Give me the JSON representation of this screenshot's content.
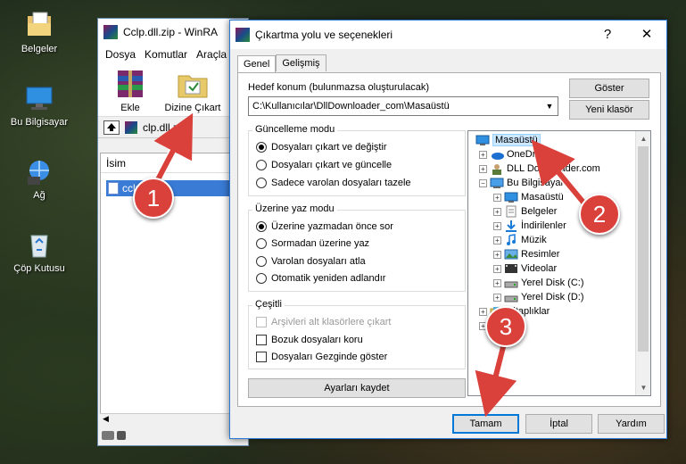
{
  "desktop": {
    "icons": [
      {
        "label": "Belgeler",
        "icon": "documents-folder-icon"
      },
      {
        "label": "Bu Bilgisayar",
        "icon": "computer-icon"
      },
      {
        "label": "Ağ",
        "icon": "network-icon"
      },
      {
        "label": "Çöp Kutusu",
        "icon": "recycle-bin-icon"
      }
    ]
  },
  "winrar": {
    "title": "Cclp.dll.zip - WinRA",
    "menu": [
      "Dosya",
      "Komutlar",
      "Araçla"
    ],
    "toolbar": {
      "add": "Ekle",
      "extract_to": "Dizine Çıkart"
    },
    "path": "clp.dll.zip",
    "column_name": "İsim",
    "file": "cclp"
  },
  "dialog": {
    "title": "Çıkartma yolu ve seçenekleri",
    "help": "?",
    "close": "✕",
    "tabs": [
      "Genel",
      "Gelişmiş"
    ],
    "dest_label": "Hedef konum (bulunmazsa oluşturulacak)",
    "dest_value": "C:\\Kullanıcılar\\DllDownloader_com\\Masaüstü",
    "show_button": "Göster",
    "new_folder_button": "Yeni klasör",
    "update_mode": {
      "title": "Güncelleme modu",
      "options": [
        "Dosyaları çıkart ve değiştir",
        "Dosyaları çıkart ve güncelle",
        "Sadece varolan dosyaları tazele"
      ],
      "selected": 0
    },
    "overwrite_mode": {
      "title": "Üzerine yaz modu",
      "options": [
        "Üzerine yazmadan önce sor",
        "Sormadan üzerine yaz",
        "Varolan dosyaları atla",
        "Otomatik yeniden adlandır"
      ],
      "selected": 0
    },
    "misc": {
      "title": "Çeşitli",
      "options": [
        {
          "label": "Arşivleri alt klasörlere çıkart",
          "checked": false,
          "disabled": true
        },
        {
          "label": "Bozuk dosyaları koru",
          "checked": false,
          "disabled": false
        },
        {
          "label": "Dosyaları Gezginde göster",
          "checked": false,
          "disabled": false
        }
      ]
    },
    "save_settings": "Ayarları kaydet",
    "tree": [
      {
        "label": "Masaüstü",
        "icon": "desktop-icon",
        "selected": true,
        "expander": ""
      },
      {
        "label": "OneDr",
        "icon": "onedrive-icon",
        "expander": "+"
      },
      {
        "label": "DLL Downloader.com",
        "icon": "user-icon",
        "expander": "+"
      },
      {
        "label": "Bu Bilgisayar",
        "icon": "computer-icon",
        "expander": "−"
      },
      {
        "label": "Masaüstü",
        "icon": "desktop-icon",
        "expander": "+"
      },
      {
        "label": "Belgeler",
        "icon": "documents-icon",
        "expander": "+"
      },
      {
        "label": "İndirilenler",
        "icon": "downloads-icon",
        "expander": "+"
      },
      {
        "label": "Müzik",
        "icon": "music-icon",
        "expander": "+"
      },
      {
        "label": "Resimler",
        "icon": "pictures-icon",
        "expander": "+"
      },
      {
        "label": "Videolar",
        "icon": "videos-icon",
        "expander": "+"
      },
      {
        "label": "Yerel Disk (C:)",
        "icon": "drive-icon",
        "expander": "+"
      },
      {
        "label": "Yerel Disk (D:)",
        "icon": "drive-icon",
        "expander": "+"
      },
      {
        "label": "Kitaplıklar",
        "icon": "libraries-icon",
        "expander": "+"
      },
      {
        "label": "",
        "icon": "network-icon",
        "expander": "+"
      }
    ],
    "ok": "Tamam",
    "cancel": "İptal",
    "help_button": "Yardım"
  },
  "annotations": [
    "1",
    "2",
    "3"
  ],
  "colors": {
    "accent": "#0078d7",
    "marker": "#d9413a",
    "selection": "#3a7bd5"
  }
}
